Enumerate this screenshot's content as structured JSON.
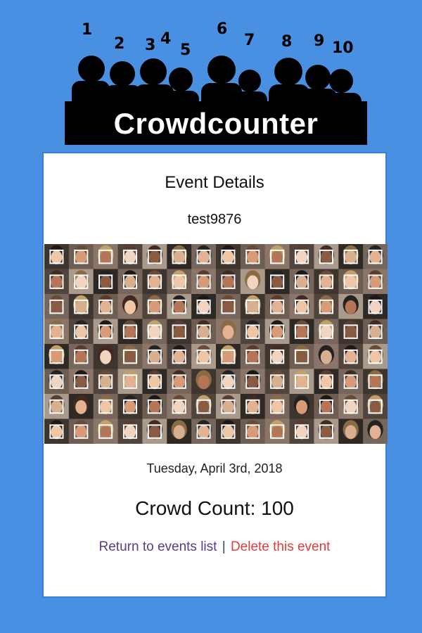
{
  "logo": {
    "text": "Crowdcounter",
    "numbers": [
      "1",
      "2",
      "3",
      "4",
      "5",
      "6",
      "7",
      "8",
      "9",
      "10"
    ]
  },
  "card": {
    "title": "Event Details",
    "event_name": "test9876",
    "date": "Tuesday, April 3rd, 2018",
    "count_label": "Crowd Count:",
    "count_value": "100",
    "return_link": "Return to events list",
    "separator": "|",
    "delete_link": "Delete this event"
  },
  "colors": {
    "background": "#4a90e2",
    "card_border": "#3c7fd1",
    "logo_black": "#000000",
    "return_link": "#5b3a89",
    "delete_link": "#e33b3b"
  },
  "photo": {
    "rows": 8,
    "columns": 14,
    "face_boxes_detected": 100,
    "box_color": "#ffffff"
  }
}
